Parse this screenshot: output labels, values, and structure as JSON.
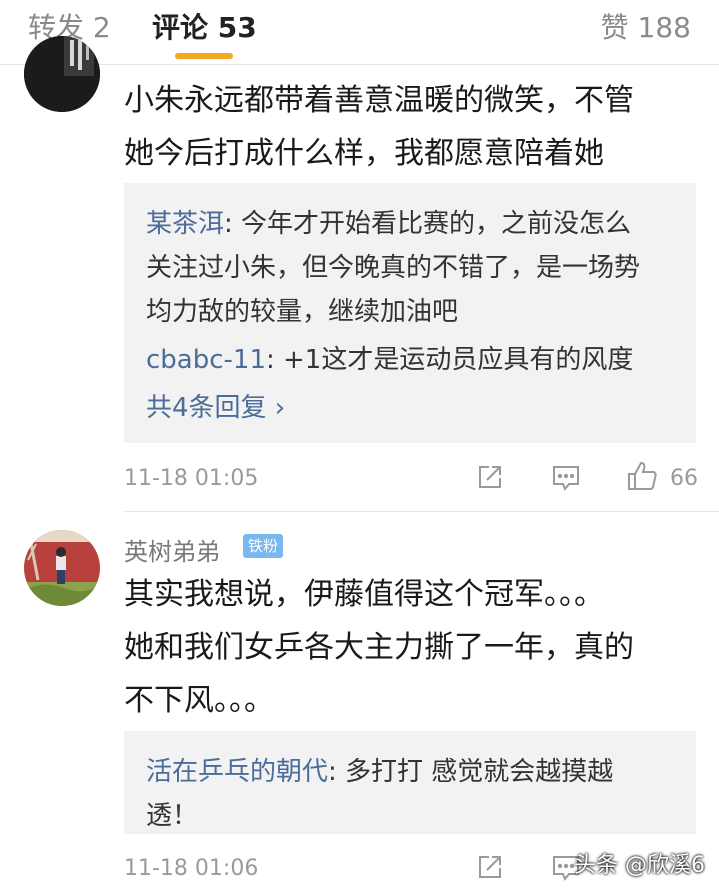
{
  "tabs": {
    "repost": "转发 2",
    "comments": "评论 53",
    "likes": "赞 188"
  },
  "comment1": {
    "text_lines": [
      "小朱永远都带着善意温暖的微笑，不管",
      "她今后打成什么样，我都愿意陪着她"
    ],
    "replies": [
      {
        "author": "某茶洱",
        "lines": [
          ": 今年才开始看比赛的，之前没怎么",
          "关注过小朱，但今晚真的不错了，是一场势",
          "均力敌的较量，继续加油吧"
        ]
      },
      {
        "author": "cbabc-11",
        "lines": [
          ": +1这才是运动员应具有的风度"
        ]
      }
    ],
    "more_replies": "共4条回复 ›",
    "time": "11-18 01:05",
    "like_count": "66"
  },
  "comment2": {
    "username": "英树弟弟",
    "badge": "铁粉",
    "text_lines": [
      "其实我想说，伊藤值得这个冠军。。。",
      "她和我们女乒各大主力撕了一年，真的",
      "不下风。。。"
    ],
    "replies": [
      {
        "author": "活在乒乓的朝代",
        "lines": [
          ": 多打打 感觉就会越摸越",
          "透！"
        ]
      }
    ],
    "time": "11-18 01:06"
  },
  "watermark": "头条 @欣溪6",
  "colors": {
    "accent": "#f5a623",
    "link": "#4a6d9a",
    "badge": "#78b7f0"
  },
  "icons": [
    "share-icon",
    "comment-icon",
    "thumbs-up-icon"
  ]
}
